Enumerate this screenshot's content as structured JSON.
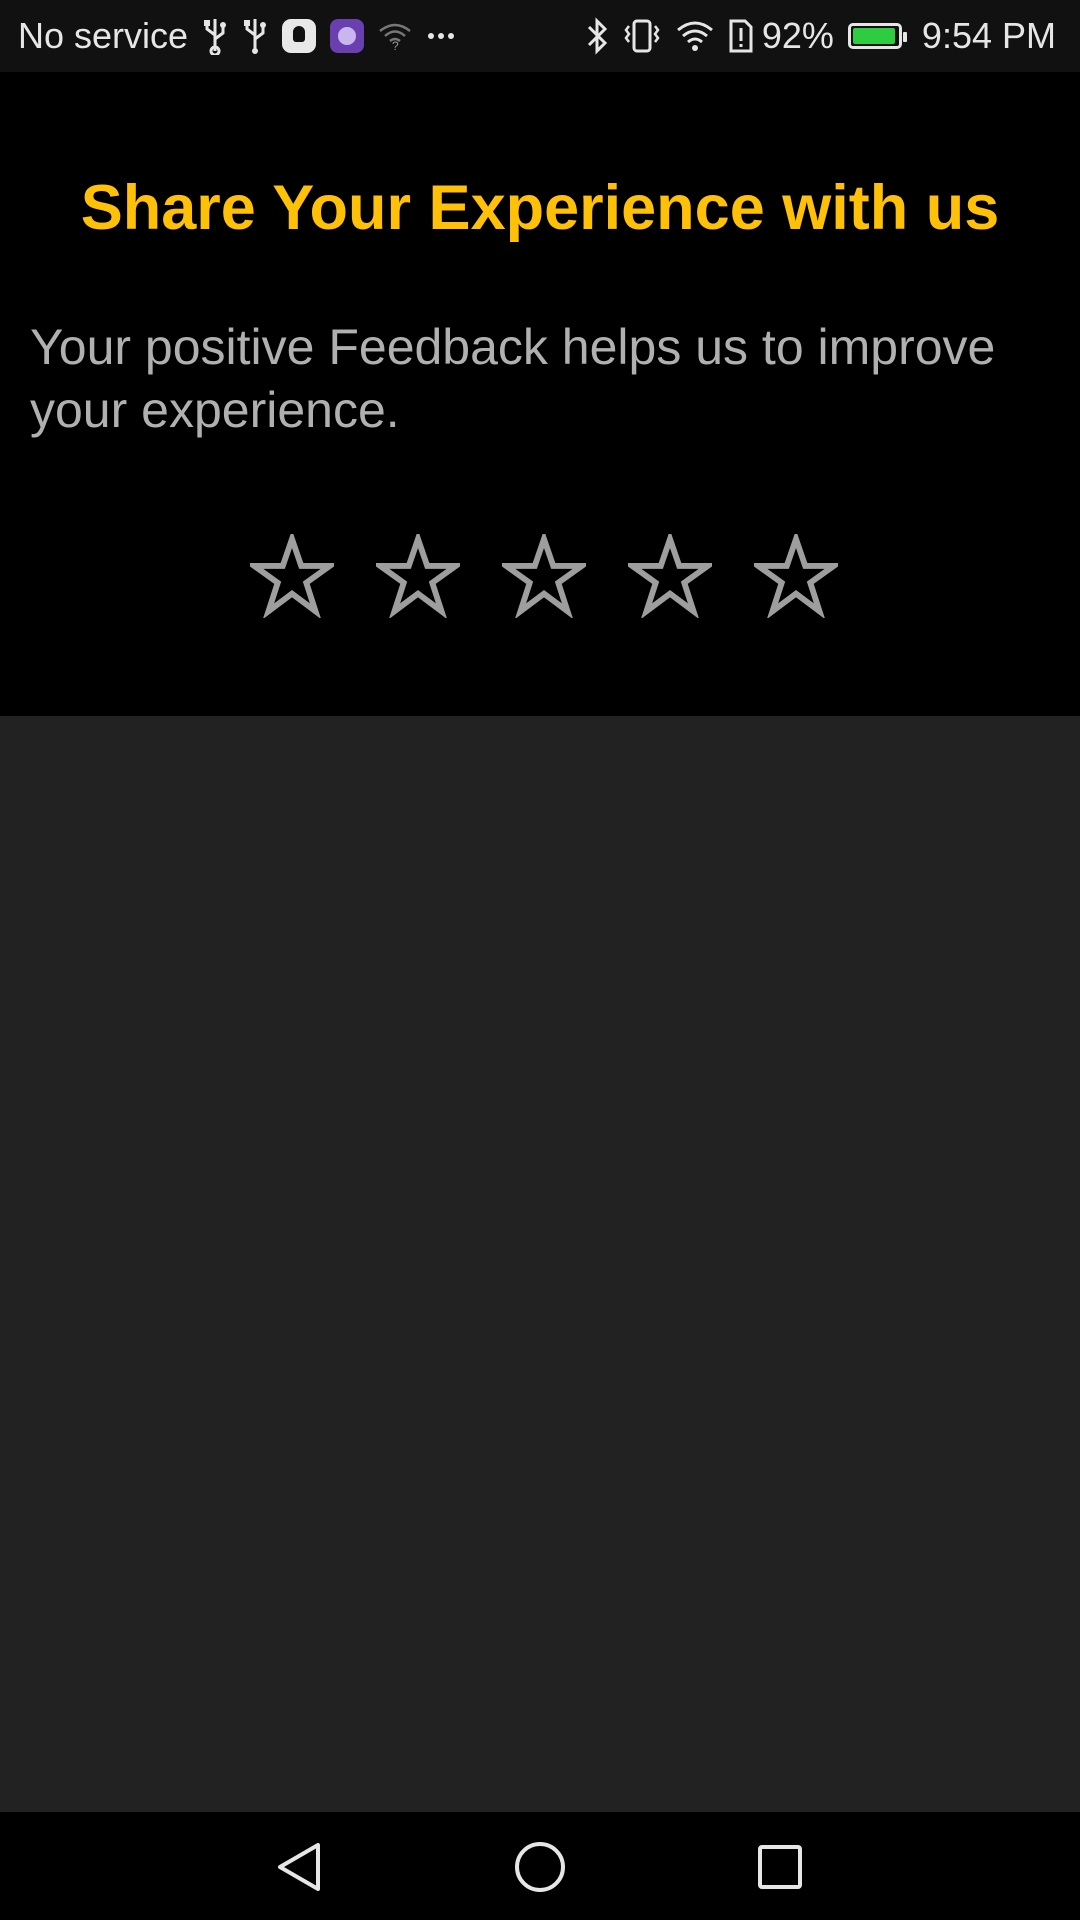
{
  "status_bar": {
    "carrier": "No service",
    "battery_percent": "92%",
    "battery_level": 0.92,
    "time": "9:54 PM",
    "left_icons": [
      "usb-icon",
      "usb-icon",
      "notification-app-icon",
      "purple-app-icon",
      "wifi-question-icon",
      "more-dots-icon"
    ],
    "right_icons": [
      "bluetooth-icon",
      "vibrate-icon",
      "wifi-icon",
      "sim-alert-icon",
      "battery-charging-icon"
    ]
  },
  "feedback": {
    "title": "Share Your Experience with us",
    "subtitle": "Your positive Feedback helps us to improve your experience.",
    "rating_max": 5,
    "rating_value": 0
  },
  "nav_bar": {
    "buttons": [
      "back-icon",
      "home-icon",
      "recents-icon"
    ]
  },
  "colors": {
    "title": "#ffc107",
    "subtitle": "#b0b0b0",
    "star_outline": "#9e9e9e",
    "panel_bg": "#000000",
    "empty_bg": "#222222"
  }
}
